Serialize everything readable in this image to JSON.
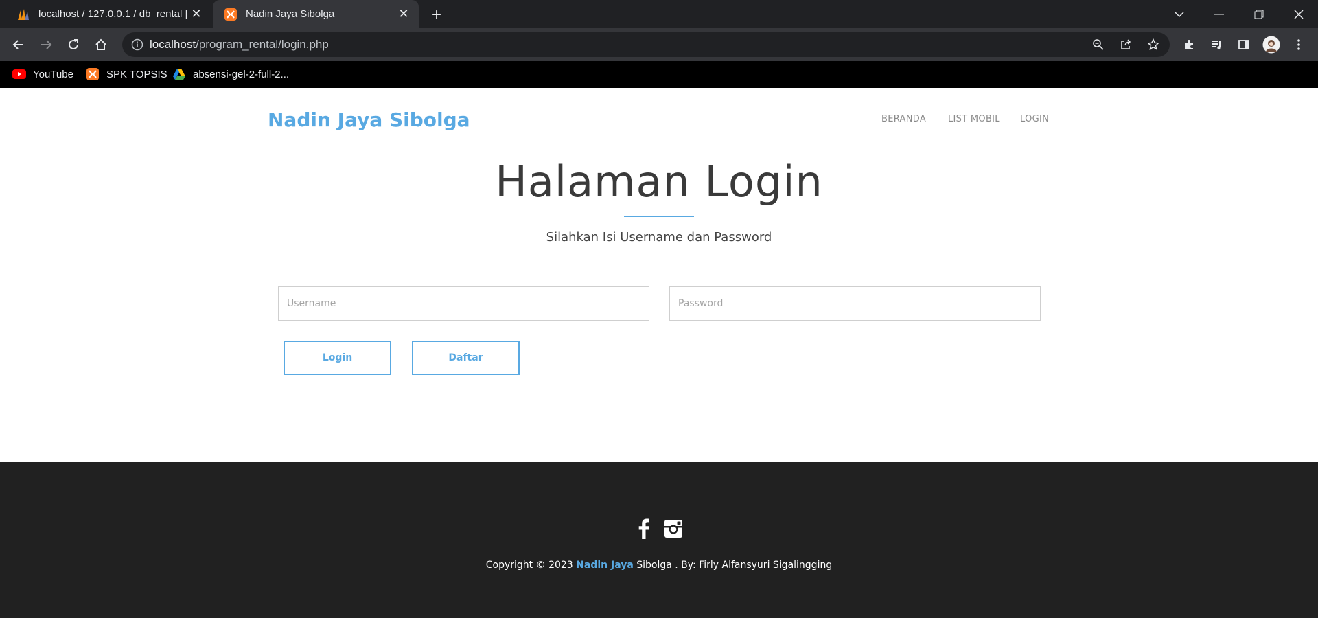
{
  "browser": {
    "tabs": [
      {
        "title": "localhost / 127.0.0.1 / db_rental |",
        "icon": "phpmyadmin-icon",
        "active": false
      },
      {
        "title": "Nadin Jaya Sibolga",
        "icon": "xampp-icon",
        "active": true
      }
    ],
    "url": {
      "host": "localhost",
      "path": "/program_rental/login.php"
    },
    "bookmarks": [
      {
        "label": "YouTube",
        "icon": "youtube-icon"
      },
      {
        "label": "SPK TOPSIS",
        "icon": "xampp-icon"
      },
      {
        "label": "absensi-gel-2-full-2...",
        "icon": "google-drive-icon"
      }
    ]
  },
  "site": {
    "brand": "Nadin Jaya Sibolga",
    "nav": [
      "BERANDA",
      "LIST MOBIL",
      "LOGIN"
    ]
  },
  "login": {
    "title": "Halaman Login",
    "subtitle": "Silahkan Isi Username dan Password",
    "username_placeholder": "Username",
    "password_placeholder": "Password",
    "login_label": "Login",
    "register_label": "Daftar"
  },
  "footer": {
    "copyright_prefix": "Copyright © 2023 ",
    "copyright_brand": "Nadin Jaya",
    "copyright_suffix": " Sibolga . By: Firly Alfansyuri Sigalingging",
    "social": [
      "facebook-icon",
      "instagram-icon"
    ]
  },
  "colors": {
    "accent": "#59a9e2",
    "footer_bg": "#212121",
    "chrome_dark": "#202124",
    "chrome_toolbar": "#35363a"
  }
}
